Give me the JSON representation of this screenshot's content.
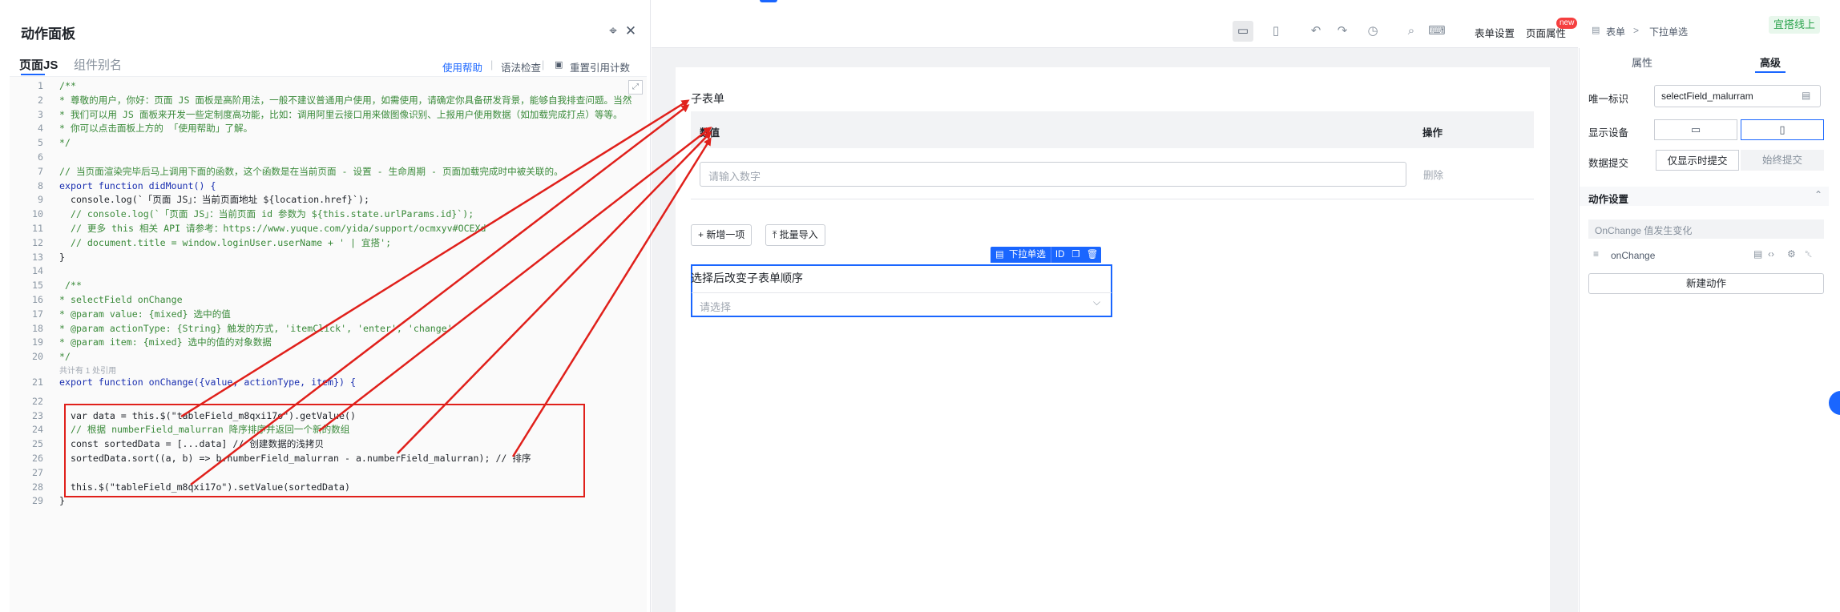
{
  "action_panel": {
    "title": "动作面板",
    "tabs": [
      {
        "label": "页面JS",
        "active": true
      },
      {
        "label": "组件别名",
        "active": false
      }
    ],
    "toolbar": {
      "help": "使用帮助",
      "syntax_check": "语法检查",
      "reset_ref_count": "重置引用计数"
    },
    "ref_hint": "共计有 1 处引用",
    "code_lines": [
      {
        "n": "1",
        "type": "comment",
        "text": "/**"
      },
      {
        "n": "2",
        "type": "comment",
        "text": "* 尊敬的用户，你好：页面 JS 面板是高阶用法，一般不建议普通用户使用，如需使用，请确定你具备研发背景，能够自我排查问题。当然"
      },
      {
        "n": "3",
        "type": "comment",
        "text": "* 我们可以用 JS 面板来开发一些定制度高功能，比如：调用阿里云接口用来做图像识别、上报用户使用数据（如加载完成打点）等等。"
      },
      {
        "n": "4",
        "type": "comment",
        "text": "* 你可以点击面板上方的 「使用帮助」了解。"
      },
      {
        "n": "5",
        "type": "comment",
        "text": "*/"
      },
      {
        "n": "6",
        "type": "plain",
        "text": ""
      },
      {
        "n": "7",
        "type": "comment",
        "text": "// 当页面渲染完毕后马上调用下面的函数，这个函数是在当前页面 - 设置 - 生命周期 - 页面加载完成时中被关联的。"
      },
      {
        "n": "8",
        "type": "kw",
        "text": "export function didMount() {"
      },
      {
        "n": "9",
        "type": "mixed",
        "text": "  console.log(`「页面 JS」：当前页面地址 ${location.href}`);"
      },
      {
        "n": "10",
        "type": "comment",
        "text": "  // console.log(`「页面 JS」：当前页面 id 参数为 ${this.state.urlParams.id}`);"
      },
      {
        "n": "11",
        "type": "link",
        "text": "  // 更多 this 相关 API 请参考：https://www.yuque.com/yida/support/ocmxyv#OCEXd"
      },
      {
        "n": "12",
        "type": "comment",
        "text": "  // document.title = window.loginUser.userName + ' | 宜搭';"
      },
      {
        "n": "13",
        "type": "plain",
        "text": "}"
      },
      {
        "n": "14",
        "type": "plain",
        "text": ""
      },
      {
        "n": "15",
        "type": "comment",
        "text": " /**"
      },
      {
        "n": "16",
        "type": "comment",
        "text": "* selectField onChange"
      },
      {
        "n": "17",
        "type": "comment",
        "text": "* @param value: {mixed} 选中的值"
      },
      {
        "n": "18",
        "type": "comment",
        "text": "* @param actionType: {String} 触发的方式, 'itemClick', 'enter', 'change'"
      },
      {
        "n": "19",
        "type": "comment",
        "text": "* @param item: {mixed} 选中的值的对象数据"
      },
      {
        "n": "20",
        "type": "comment",
        "text": "*/"
      },
      {
        "n": "21",
        "type": "kw",
        "text": "export function onChange({value, actionType, item}) {"
      },
      {
        "n": "22",
        "type": "plain",
        "text": ""
      },
      {
        "n": "23",
        "type": "mixed2",
        "text": "  var data = this.$(\"tableField_m8qxi17o\").getValue()"
      },
      {
        "n": "24",
        "type": "comment",
        "text": "  // 根据 numberField_malurran 降序排序并返回一个新的数组"
      },
      {
        "n": "25",
        "type": "mixed3",
        "text": "  const sortedData = [...data] // 创建数据的浅拷贝"
      },
      {
        "n": "26",
        "type": "mixed4",
        "text": "  sortedData.sort((a, b) => b.numberField_malurran - a.numberField_malurran); // 排序"
      },
      {
        "n": "27",
        "type": "plain",
        "text": ""
      },
      {
        "n": "28",
        "type": "mixed2",
        "text": "  this.$(\"tableField_m8qxi17o\").setValue(sortedData)"
      },
      {
        "n": "29",
        "type": "plain",
        "text": "}"
      }
    ]
  },
  "canvas_toolbar": {
    "form_settings": "表单设置",
    "page_props": "页面属性",
    "new_badge": "new"
  },
  "form": {
    "subform_title": "子表单",
    "col_value": "数值",
    "col_ops": "操作",
    "number_placeholder": "请输入数字",
    "delete": "删除",
    "add_item": "+ 新增一项",
    "bulk_import": "批量导入",
    "field_toolbar_label": "下拉单选",
    "field_toolbar_id": "ID",
    "field_label": "选择后改变子表单顺序",
    "select_placeholder": "请选择"
  },
  "right_panel": {
    "breadcrumb_form": "表单",
    "breadcrumb_sep": ">",
    "breadcrumb_field": "下拉单选",
    "publish": "宜搭线上",
    "tabs": [
      {
        "label": "属性",
        "active": false
      },
      {
        "label": "高级",
        "active": true
      }
    ],
    "uid_label": "唯一标识",
    "uid_value": "selectField_malurram",
    "display_device_label": "显示设备",
    "data_submit_label": "数据提交",
    "submit_opt_1": "仅显示时提交",
    "submit_opt_2": "始终提交",
    "action_settings": "动作设置",
    "event_hint": "OnChange 值发生变化",
    "event_name": "onChange",
    "new_action": "新建动作"
  },
  "colors": {
    "accent": "#1a66ff",
    "annotation_red": "#e0201b",
    "comment_green": "#3a8a3a",
    "keyword_blue": "#1a2fb0",
    "string_red": "#a31515"
  }
}
